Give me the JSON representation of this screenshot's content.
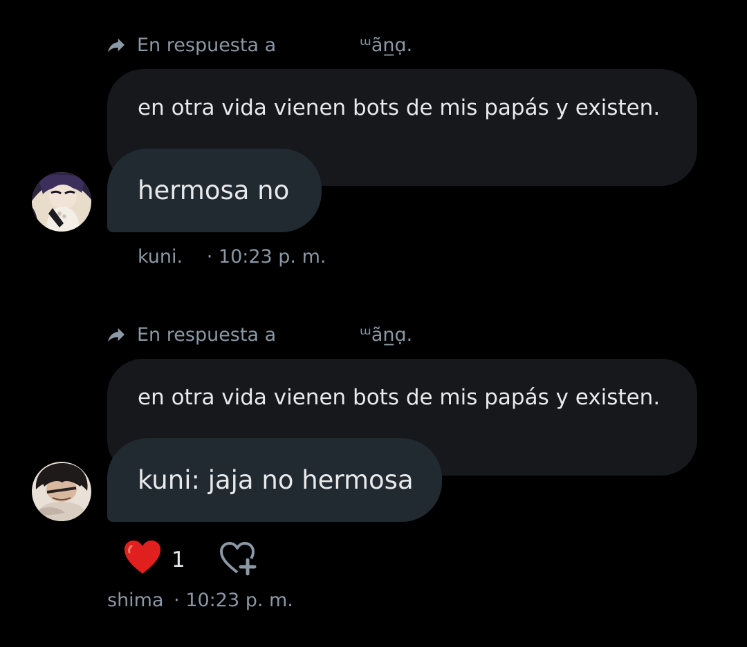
{
  "messages": [
    {
      "reply_label": "En respuesta a",
      "reply_to": "ᵚãn̲ɑ̣.",
      "quoted_text": "en otra vida vienen bots de mis papás y existen.",
      "message_text": "hermosa no",
      "sender": "kuni.",
      "separator": "·",
      "time": "10:23 p. m.",
      "avatar_icon": "avatar-anime-girl-purple-hair"
    },
    {
      "reply_label": "En respuesta a",
      "reply_to": "ᵚãn̲ɑ̣.",
      "quoted_text": "en otra vida vienen bots de mis papás y existen.",
      "message_text": "kuni: jaja no hermosa",
      "reaction_emoji": "❤️",
      "reaction_count": "1",
      "add_reaction_icon": "heart-plus-icon",
      "sender": "shima",
      "separator": "·",
      "time": "10:23 p. m.",
      "avatar_icon": "avatar-anime-boy-dark-hair"
    }
  ],
  "colors": {
    "background": "#000000",
    "quoted_bubble": "#16181c",
    "message_bubble": "#222a31",
    "secondary_text": "#8b98a5",
    "primary_text": "#e7e9ea",
    "heart": "#e0201f"
  }
}
